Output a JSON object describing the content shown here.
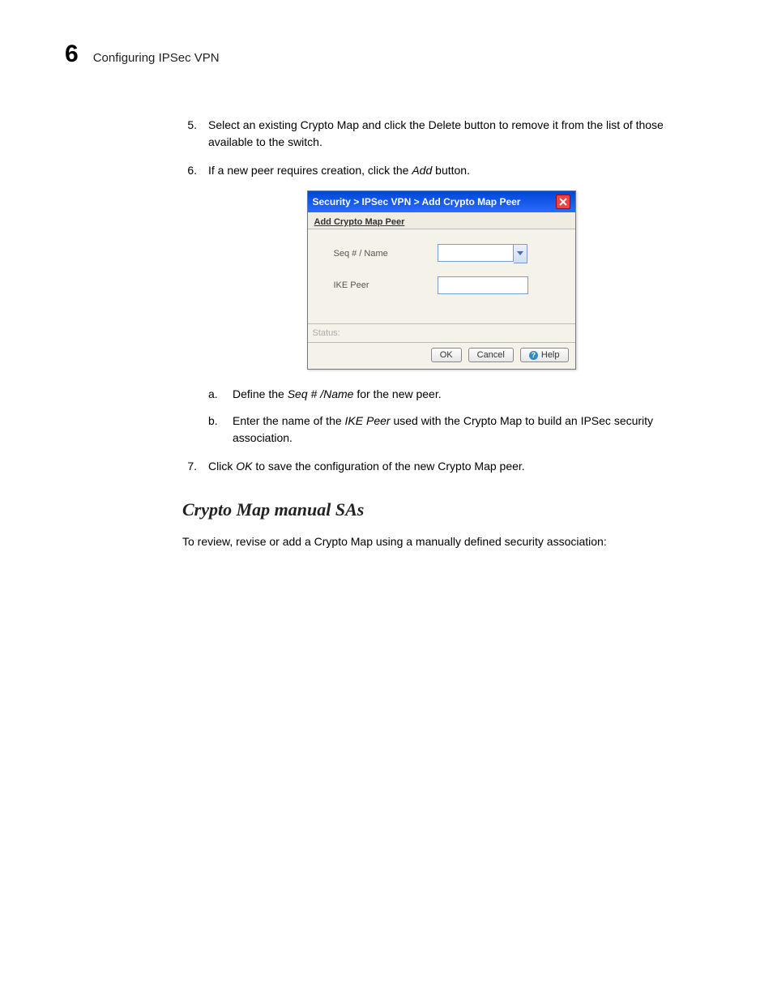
{
  "header": {
    "chapter_number": "6",
    "title": "Configuring IPSec VPN"
  },
  "steps": {
    "five": {
      "num": "5.",
      "text_before": "Select an existing Crypto Map and click the Delete button to remove it from the list of those available to the switch."
    },
    "six": {
      "num": "6.",
      "text_prefix": "If a new peer requires creation, click the ",
      "italic": "Add",
      "text_suffix": " button."
    },
    "seven": {
      "num": "7.",
      "text_prefix": "Click ",
      "italic": "OK",
      "text_suffix": " to save the configuration of the new Crypto Map peer."
    }
  },
  "substeps": {
    "a": {
      "letter": "a.",
      "text_prefix": "Define the ",
      "italic": "Seq # /Name",
      "text_suffix": " for the new peer."
    },
    "b": {
      "letter": "b.",
      "text_prefix": "Enter the name of the ",
      "italic": "IKE Peer",
      "text_suffix": " used with the Crypto Map to build an IPSec security association."
    }
  },
  "dialog": {
    "breadcrumb": "Security > IPSec VPN > Add Crypto Map Peer",
    "tab_label": "Add Crypto Map Peer",
    "fields": {
      "seq_label": "Seq # / Name",
      "seq_value": "",
      "ike_label": "IKE Peer",
      "ike_value": ""
    },
    "status_label": "Status:",
    "buttons": {
      "ok": "OK",
      "cancel": "Cancel",
      "help": "Help"
    }
  },
  "section": {
    "heading": "Crypto Map manual SAs",
    "intro": "To review, revise or add a Crypto Map using a manually defined security association:"
  }
}
